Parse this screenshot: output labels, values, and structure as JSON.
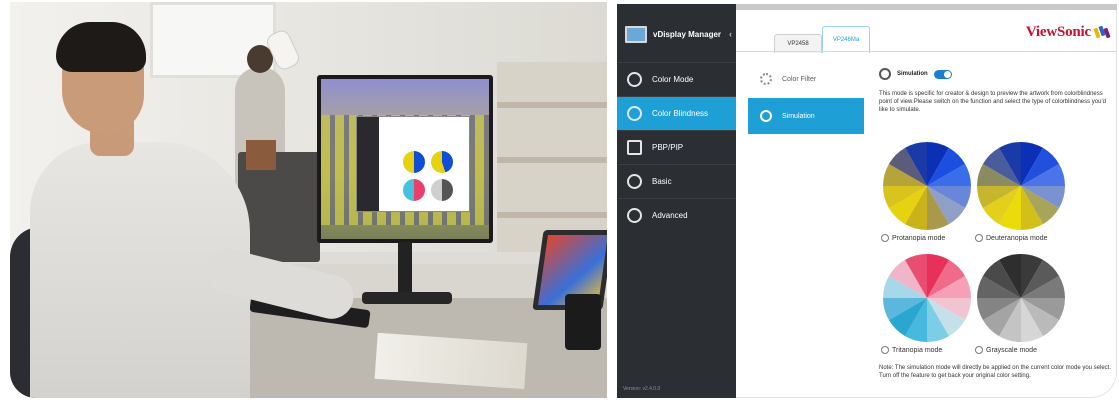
{
  "app": {
    "title": "vDisplay Manager",
    "version": "Version: v2.4.0.0",
    "sidebar": [
      {
        "label": "Color Mode",
        "icon": "color-mode-icon",
        "active": false
      },
      {
        "label": "Color Blindness",
        "icon": "color-blindness-icon",
        "active": true
      },
      {
        "label": "PBP/PIP",
        "icon": "pbp-pip-icon",
        "active": false
      },
      {
        "label": "Basic",
        "icon": "basic-gear-icon",
        "active": false
      },
      {
        "label": "Advanced",
        "icon": "advanced-icon",
        "active": false
      }
    ],
    "tabs": [
      {
        "label": "VP2458",
        "active": false
      },
      {
        "label": "VP246Ma",
        "active": true
      }
    ],
    "brand": "ViewSonic",
    "subnav": [
      {
        "label": "Color Filter",
        "active": false
      },
      {
        "label": "Simulation",
        "active": true
      }
    ],
    "simulation": {
      "label": "Simulation",
      "enabled": true,
      "description": "This mode is specific for creator & design to preview the artwork from colorblindness point of view.Please switch on the function and select the type of colorblindness you'd like to simulate."
    },
    "modes": [
      {
        "label": "Protanopia mode"
      },
      {
        "label": "Deuteranopia mode"
      },
      {
        "label": "Tritanopia mode"
      },
      {
        "label": "Grayscale mode"
      }
    ],
    "note": "Note: The simulation mode will directly be applied on the current color mode you select. Turn off the feature to get back your original color setting."
  },
  "colors": {
    "accent": "#1e9fd6",
    "sidebar_bg": "#2b2f33",
    "brand_red": "#c8102e",
    "toggle_on": "#1e7fd0"
  }
}
